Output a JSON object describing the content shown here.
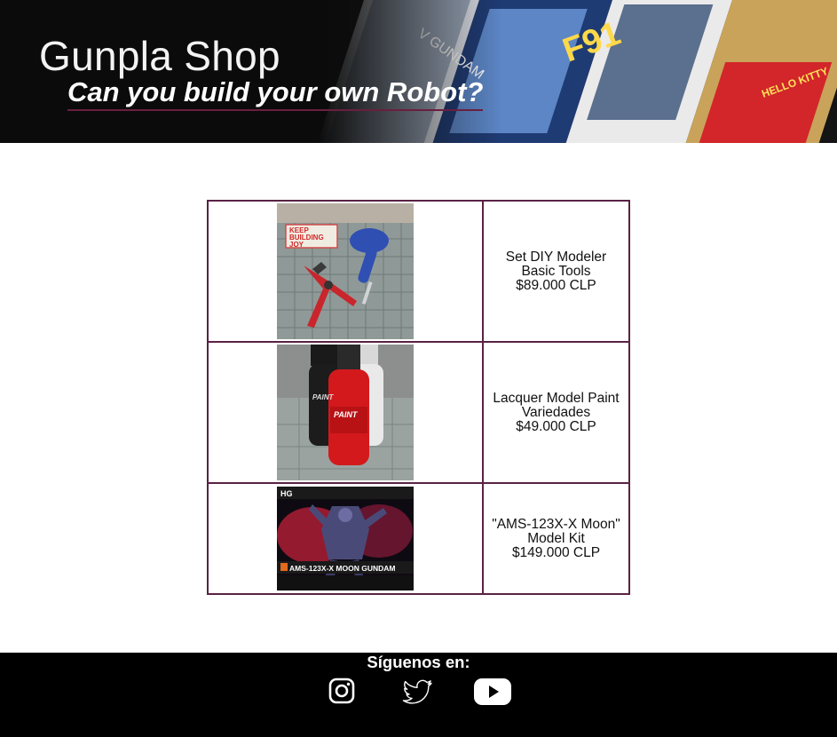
{
  "header": {
    "title": "Gunpla Shop",
    "subtitle": "Can you build your own Robot?",
    "banner": "gunpla-model-kit-boxes-banner"
  },
  "products": [
    {
      "image": "diy-modeler-tools-photo",
      "image_text": [
        "KEEP",
        "BUILDING",
        "JOY"
      ],
      "name_line1": "Set DIY Modeler",
      "name_line2": "Basic Tools",
      "price": "$89.000 CLP"
    },
    {
      "image": "lacquer-paint-bottles-photo",
      "image_text": [
        "PAINT"
      ],
      "name_line1": "Lacquer Model Paint",
      "name_line2": "Variedades",
      "price": "$49.000 CLP"
    },
    {
      "image": "moon-gundam-box-art",
      "image_text": [
        "HG",
        "AMS-123X-X MOON GUNDAM"
      ],
      "name_line1": "\"AMS-123X-X Moon\"",
      "name_line2": "Model Kit",
      "price": "$149.000 CLP"
    }
  ],
  "footer": {
    "heading": "Síguenos en:",
    "social": [
      "instagram-icon",
      "twitter-icon",
      "youtube-icon"
    ]
  },
  "colors": {
    "header_bg": "#0b0b0b",
    "table_border": "#5a2244",
    "subtitle_underline": "#6b1f3e",
    "footer_bg": "#000000"
  }
}
